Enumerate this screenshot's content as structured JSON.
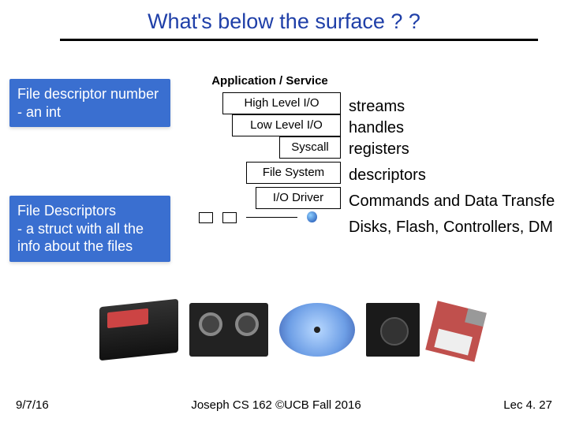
{
  "title": "What's below the surface ? ?",
  "callouts": {
    "fd_number": {
      "line1": "File descriptor number",
      "line2": " - an int"
    },
    "fd_struct": {
      "line1": "File Descriptors",
      "line2": " - a struct with all the",
      "line3": "info about the files"
    }
  },
  "stack": {
    "header": "Application / Service",
    "high": "High Level I/O",
    "low": "Low Level I/O",
    "syscall": "Syscall",
    "fs": "File System",
    "io": "I/O Driver"
  },
  "labels": {
    "streams": "streams",
    "handles": "handles",
    "registers": "registers",
    "descriptors": "descriptors",
    "cmds": "Commands and Data Transfe",
    "disks": "Disks, Flash, Controllers, DM"
  },
  "footer": {
    "date": "9/7/16",
    "center": "Joseph CS 162 ©UCB Fall 2016",
    "right": "Lec 4. 27"
  }
}
